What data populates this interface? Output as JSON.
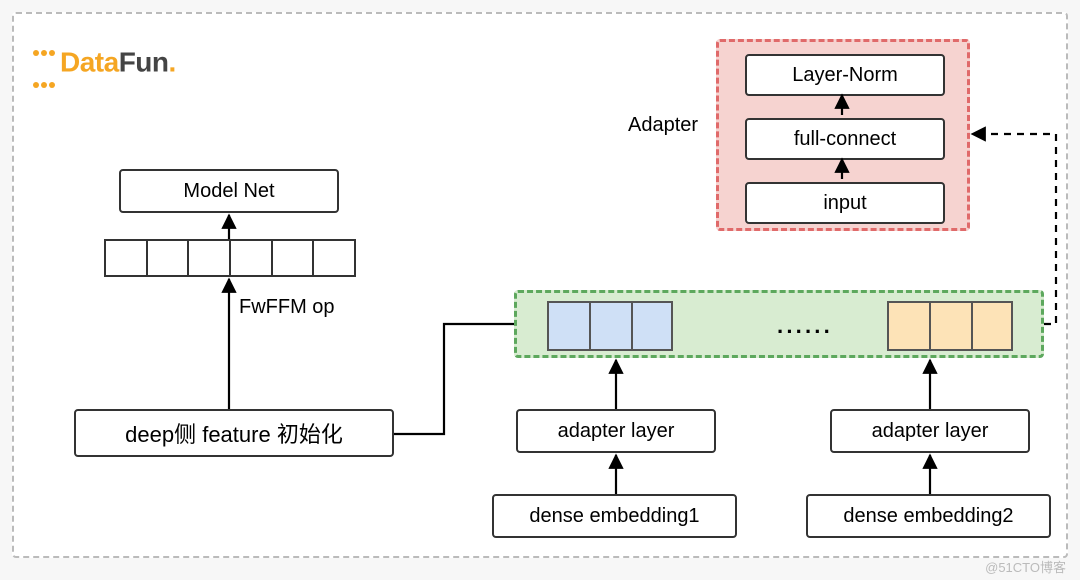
{
  "logo": {
    "text1": "Data",
    "text2": "Fun",
    "dot": "."
  },
  "left": {
    "model_net": "Model Net",
    "fwffm": "FwFFM op",
    "deep_feature": "deep侧 feature 初始化"
  },
  "adapter_panel": {
    "label": "Adapter",
    "layer_norm": "Layer-Norm",
    "full_connect": "full-connect",
    "input": "input"
  },
  "green_panel": {
    "ellipsis": "······"
  },
  "bottom": {
    "adapter_layer_1": "adapter layer",
    "adapter_layer_2": "adapter layer",
    "dense_embedding_1": "dense embedding1",
    "dense_embedding_2": "dense embedding2"
  },
  "watermark": "@51CTO博客",
  "chart_data": {
    "type": "diagram",
    "title": "",
    "nodes": [
      {
        "id": "model_net",
        "label": "Model Net"
      },
      {
        "id": "embedding_row",
        "label": "embedding cells (6)"
      },
      {
        "id": "fwffm_op",
        "label": "FwFFM op"
      },
      {
        "id": "deep_feature_init",
        "label": "deep侧 feature 初始化"
      },
      {
        "id": "green_group",
        "label": "concatenated pretrained embeddings"
      },
      {
        "id": "adapter_layer_1",
        "label": "adapter layer"
      },
      {
        "id": "adapter_layer_2",
        "label": "adapter layer"
      },
      {
        "id": "dense_embedding_1",
        "label": "dense embedding1"
      },
      {
        "id": "dense_embedding_2",
        "label": "dense embedding2"
      },
      {
        "id": "adapter_module",
        "label": "Adapter"
      },
      {
        "id": "adapter_input",
        "label": "input"
      },
      {
        "id": "adapter_full_connect",
        "label": "full-connect"
      },
      {
        "id": "adapter_layer_norm",
        "label": "Layer-Norm"
      }
    ],
    "edges": [
      {
        "from": "deep_feature_init",
        "to": "fwffm_op",
        "style": "solid"
      },
      {
        "from": "fwffm_op",
        "to": "embedding_row",
        "style": "solid"
      },
      {
        "from": "embedding_row",
        "to": "model_net",
        "style": "solid"
      },
      {
        "from": "green_group",
        "to": "deep_feature_init",
        "style": "solid",
        "note": "merge into deep feature init"
      },
      {
        "from": "dense_embedding_1",
        "to": "adapter_layer_1",
        "style": "solid"
      },
      {
        "from": "adapter_layer_1",
        "to": "green_group",
        "style": "solid"
      },
      {
        "from": "dense_embedding_2",
        "to": "adapter_layer_2",
        "style": "solid"
      },
      {
        "from": "adapter_layer_2",
        "to": "green_group",
        "style": "solid"
      },
      {
        "from": "green_group",
        "to": "adapter_module",
        "style": "dashed"
      },
      {
        "from": "adapter_input",
        "to": "adapter_full_connect",
        "style": "solid"
      },
      {
        "from": "adapter_full_connect",
        "to": "adapter_layer_norm",
        "style": "solid"
      }
    ]
  }
}
